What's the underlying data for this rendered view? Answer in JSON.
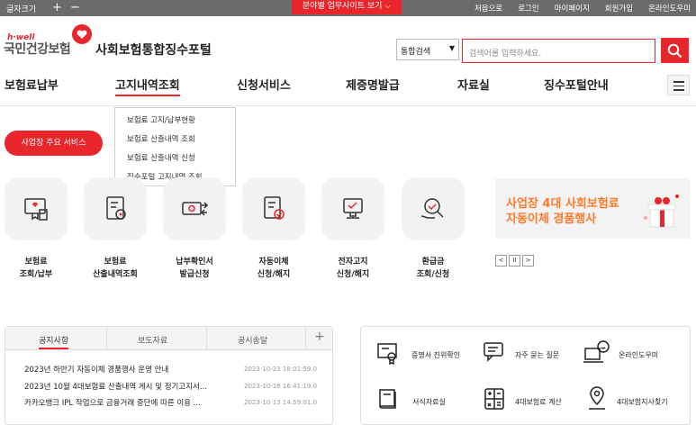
{
  "topbar": {
    "font_size_label": "글자크기",
    "plus": "+",
    "minus": "−",
    "branch_site": "분야별 업무사이트 보기 ⌵",
    "links": [
      "처음으로",
      "로그인",
      "마이페이지",
      "회원가입",
      "온라인도우미"
    ]
  },
  "header": {
    "logo_eng": "h·well",
    "logo_kor": "국민건강보험",
    "portal_title": "사회보험통합징수포털",
    "search_scope": "통합검색",
    "search_placeholder": "검색어를 입력하세요."
  },
  "nav": {
    "items": [
      "보험료납부",
      "고지내역조회",
      "신청서비스",
      "제증명발급",
      "자료실",
      "징수포털안내"
    ],
    "active": "고지내역조회"
  },
  "dropdown": {
    "items": [
      "보험료 고지/납부현황",
      "보험료 산출내역 조회",
      "보험료 산출내역 신청",
      "징수포털 고지내역 조회"
    ]
  },
  "services": {
    "pill": "사업장 주요 서비스",
    "items": [
      {
        "line1": "보험료",
        "line2": "조회/납부",
        "icon": "bill-icon"
      },
      {
        "line1": "보험료",
        "line2": "산출내역조회",
        "icon": "document-calc-icon"
      },
      {
        "line1": "납부확인서",
        "line2": "발급신청",
        "icon": "money-transfer-icon"
      },
      {
        "line1": "자동이체",
        "line2": "신청/해지",
        "icon": "auto-debit-icon"
      },
      {
        "line1": "전자고지",
        "line2": "신청/해지",
        "icon": "e-notice-icon"
      },
      {
        "line1": "환급금",
        "line2": "조회/신청",
        "icon": "refund-search-icon"
      }
    ]
  },
  "banner": {
    "line1": "사업장 4대 사회보험료",
    "line2": "자동이체 경품행사",
    "prev": "<",
    "pause": "II",
    "next": ">"
  },
  "notice": {
    "tabs": [
      "공지사항",
      "보도자료",
      "공시송달"
    ],
    "active_tab": "공지사항",
    "more": "+",
    "rows": [
      {
        "title": "2023년 하반기 자동이체 경품행사 운영 안내",
        "date": "2023-10-23 18:01:59.0"
      },
      {
        "title": "2023년 10월 4대보험료 산출내역 게시 및 정기고지서...",
        "date": "2023-10-16 16:41:19.0"
      },
      {
        "title": "카카오뱅크 IPL 작업으로 금융거래 중단에 따른 이용 ...",
        "date": "2023-10-13 14:59:01.0"
      }
    ]
  },
  "quick": {
    "items": [
      {
        "label": "증명서 진위확인",
        "icon": "certificate-icon"
      },
      {
        "label": "자주 묻는 질문",
        "icon": "faq-chat-icon"
      },
      {
        "label": "온라인도우미",
        "icon": "online-helper-icon"
      },
      {
        "label": "서식자료실",
        "icon": "forms-book-icon"
      },
      {
        "label": "4대보험료 계산",
        "icon": "calculator-icon"
      },
      {
        "label": "4대보험지사찾기",
        "icon": "location-pin-icon"
      }
    ]
  },
  "colors": {
    "accent": "#e8262b",
    "topbar": "#6b6b6b",
    "banner_text": "#ff7a2a"
  }
}
